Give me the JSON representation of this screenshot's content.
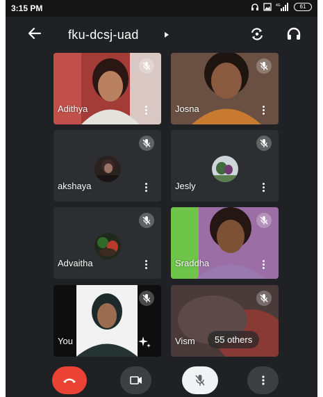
{
  "status_bar": {
    "time": "3:15 PM",
    "battery": "61"
  },
  "header": {
    "meeting_code": "fku-dcsj-uad"
  },
  "participants": [
    {
      "name": "Adithya"
    },
    {
      "name": "Josna"
    },
    {
      "name": "akshaya"
    },
    {
      "name": "Jesly"
    },
    {
      "name": "Advaitha"
    },
    {
      "name": "Sraddha"
    },
    {
      "name": "You"
    },
    {
      "name": "Vism"
    }
  ],
  "others_count": "55 others",
  "colors": {
    "background": "#202124",
    "end_call": "#ea4335",
    "tile": "#2d2e31"
  }
}
